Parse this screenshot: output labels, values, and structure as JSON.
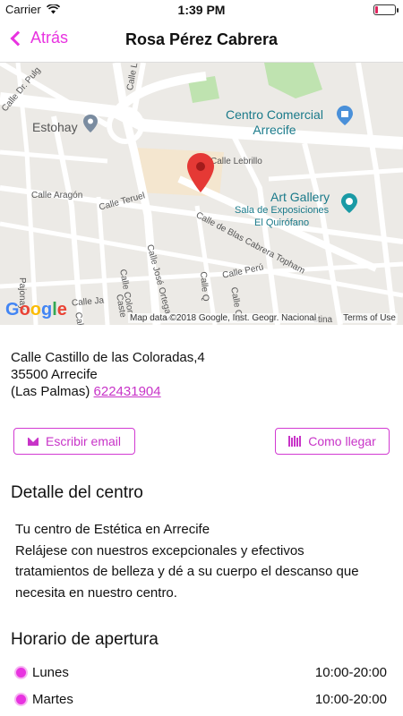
{
  "status_bar": {
    "carrier": "Carrier",
    "time": "1:39 PM"
  },
  "nav": {
    "back_label": "Atrás",
    "title": "Rosa Pérez Cabrera"
  },
  "map": {
    "street_labels": [
      "Calle Dr. Pulg",
      "Calle Li",
      "Calle Lebrillo",
      "Calle Aragón",
      "Calle Teruel",
      "Calle de Blas Cabrera Topham",
      "Calle Perú",
      "Calle José Ortega y",
      "Calle Color",
      "Calle Q",
      "Calle Qu",
      "Pajonay",
      "Calle Ja",
      "Caste",
      "stina",
      "Calle J"
    ],
    "poi_estohay": "Estohay",
    "poi_centro_line1": "Centro Comercial",
    "poi_centro_line2": "Arrecife",
    "poi_gallery": "Art Gallery",
    "poi_sala_line1": "Sala de Exposiciones",
    "poi_sala_line2": "El Quirófano",
    "google_logo": "Google",
    "attribution": "Map data ©2018 Google, Inst. Geogr. Nacional",
    "terms": "Terms of Use"
  },
  "address": {
    "line1": "Calle Castillo de las Coloradas,4",
    "line2": "35500 Arrecife",
    "line3": "(Las Palmas)",
    "phone": "622431904"
  },
  "actions": {
    "email_label": "Escribir email",
    "directions_label": "Como llegar"
  },
  "detail": {
    "title": "Detalle del centro",
    "lines": [
      "Tu centro de Estética en Arrecife",
      "Relájese con nuestros excepcionales y efectivos",
      "tratamientos de belleza y dé a su cuerpo el descanso que",
      "necesita en nuestro centro."
    ]
  },
  "hours": {
    "title": "Horario de apertura",
    "rows": [
      {
        "day": "Lunes",
        "time": "10:00-20:00"
      },
      {
        "day": "Martes",
        "time": "10:00-20:00"
      }
    ]
  },
  "colors": {
    "accent": "#e833e0",
    "link": "#c834c8",
    "poi": "#1a7a8a",
    "map_bg": "#eceae6"
  }
}
